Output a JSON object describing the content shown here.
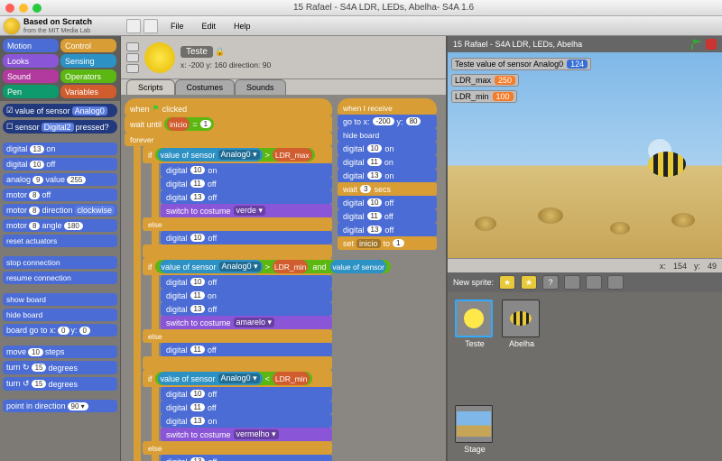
{
  "window": {
    "title": "15 Rafael - S4A LDR, LEDs, Abelha- S4A 1.6",
    "close": "●",
    "min": "●",
    "zoom": "●"
  },
  "branding": {
    "line1": "Based on Scratch",
    "line2": "from the MIT Media Lab"
  },
  "menu": {
    "file": "File",
    "edit": "Edit",
    "help": "Help"
  },
  "categories": {
    "motion": "Motion",
    "control": "Control",
    "looks": "Looks",
    "sensing": "Sensing",
    "sound": "Sound",
    "operators": "Operators",
    "pen": "Pen",
    "variables": "Variables"
  },
  "palette": {
    "value_of_sensor": "value of sensor",
    "analog0": "Analog0",
    "sensor": "sensor",
    "digital2": "Digital2",
    "pressed": "pressed?",
    "digital": "digital",
    "on": "on",
    "off": "off",
    "analog": "analog",
    "value": "value",
    "motor": "motor",
    "direction": "direction",
    "clockwise": "clockwise",
    "angle": "angle",
    "d13": "13",
    "d10": "10",
    "a9": "9",
    "v255": "255",
    "m8": "8",
    "ang180": "180",
    "reset": "reset actuators",
    "stop": "stop connection",
    "resume": "resume connection",
    "show": "show board",
    "hide": "hide board",
    "boardgo": "board go to x:",
    "y": "y:",
    "z0": "0",
    "move": "move",
    "steps": "steps",
    "s10": "10",
    "turnr": "turn ↻",
    "turnl": "turn ↺",
    "deg": "degrees",
    "d15": "15",
    "point": "point in direction",
    "d90": "90 ▾"
  },
  "sprite": {
    "name": "Teste",
    "coords": "x: -200  y: 160   direction: 90",
    "lock": "🔒"
  },
  "tabs": {
    "scripts": "Scripts",
    "costumes": "Costumes",
    "sounds": "Sounds"
  },
  "script": {
    "when_clicked": "when",
    "clicked": "clicked",
    "wait_until": "wait until",
    "inicio": "inicio",
    "eq": "=",
    "one": "1",
    "forever": "forever",
    "if": "if",
    "else": "else",
    "vos": "value of sensor",
    "a0": "Analog0 ▾",
    "gt": ">",
    "lt": "<",
    "and": "and",
    "ldr_max": "LDR_max",
    "ldr_min": "LDR_min",
    "digital": "digital",
    "on": "on",
    "off": "off",
    "d10": "10",
    "d11": "11",
    "d13": "13",
    "switch": "switch to costume",
    "verde": "verde ▾",
    "amarelo": "amarelo ▾",
    "vermelho": "vermelho ▾",
    "when_receive": "when I receive",
    "goto": "go to x:",
    "x200": "-200",
    "y": "y:",
    "hideboard": "hide board",
    "wait": "wait",
    "secs": "secs",
    "s3": "3",
    "set": "set",
    "to": "to"
  },
  "stage": {
    "title": "15 Rafael - S4A LDR, LEDs, Abelha",
    "mon1_label": "Teste value of sensor Analog0",
    "mon1_val": "124",
    "mon2_label": "LDR_max",
    "mon2_val": "250",
    "mon3_label": "LDR_min",
    "mon3_val": "100",
    "x_lbl": "x:",
    "x_val": "154",
    "y_lbl": "y:",
    "y_val": "49"
  },
  "newsprite": {
    "label": "New sprite:"
  },
  "sprites": {
    "teste": "Teste",
    "abelha": "Abelha",
    "stage": "Stage"
  }
}
